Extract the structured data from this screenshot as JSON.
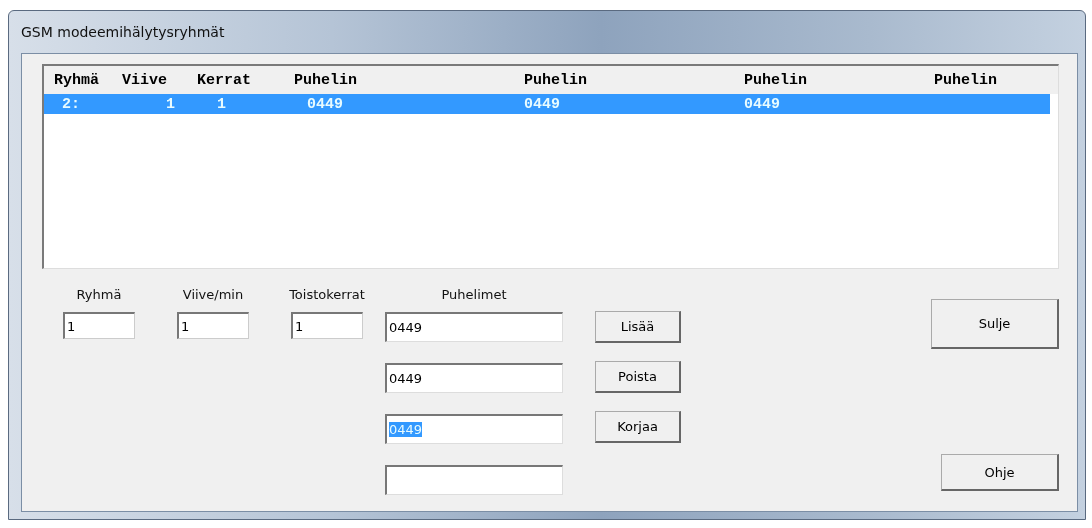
{
  "window": {
    "title": "GSM modeemihälytysryhmät"
  },
  "list": {
    "columns": [
      "Ryhmä",
      "Viive",
      "Kerrat",
      "Puhelin",
      "Puhelin",
      "Puhelin",
      "Puhelin"
    ],
    "rows": [
      {
        "cells": [
          "2:",
          "1",
          "1",
          "0449",
          "0449",
          "0449"
        ],
        "selected": true
      }
    ]
  },
  "fields": [
    {
      "label": "Ryhmä",
      "value": "1"
    },
    {
      "label": "Viive/min",
      "value": "1"
    },
    {
      "label": "Toistokerrat",
      "value": "1"
    }
  ],
  "phones": {
    "label": "Puhelimet",
    "items": [
      {
        "value": "0449",
        "selected": false
      },
      {
        "value": "0449",
        "selected": false
      },
      {
        "value": "0449",
        "selected": true
      },
      {
        "value": "",
        "selected": false
      }
    ]
  },
  "row_buttons": [
    "Lisää",
    "Poista",
    "Korjaa"
  ],
  "close_button": "Sulje",
  "help_button": "Ohje"
}
